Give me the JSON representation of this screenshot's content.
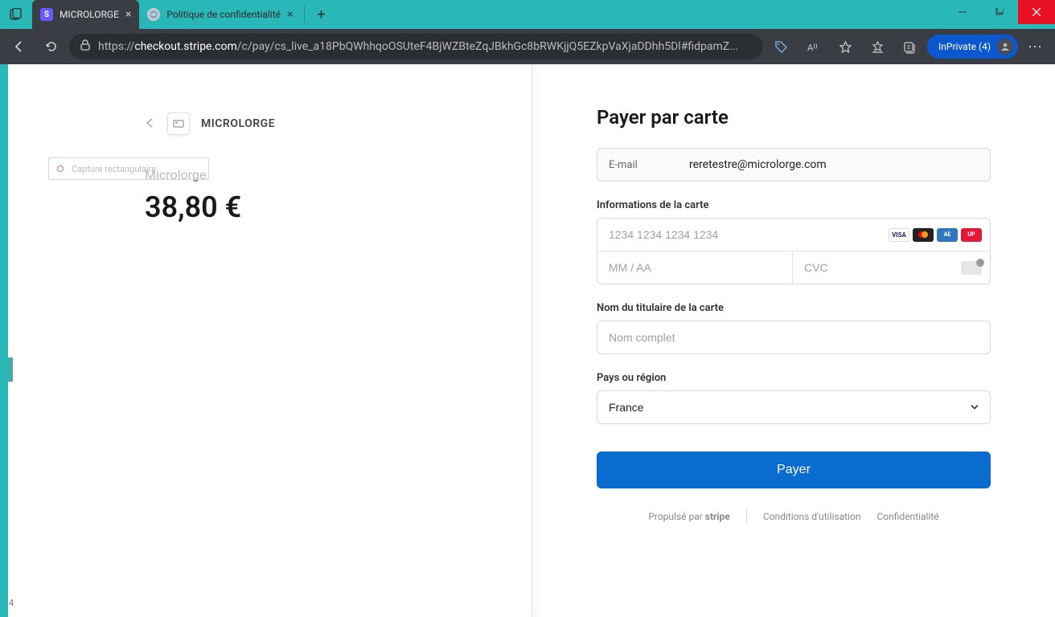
{
  "browser": {
    "tabs": [
      {
        "title": "MICROLORGE",
        "active": true
      },
      {
        "title": "Politique de confidentialité",
        "active": false
      }
    ],
    "url_prefix": "https://",
    "url_domain": "checkout.stripe.com",
    "url_path": "/c/pay/cs_live_a18PbQWhhqoOSUteF4BjWZBteZqJBkhGc8bRWKjjQ5EZkpVaXjaDDhh5Dl#fidpamZ...",
    "inprivate_label": "InPrivate (4)"
  },
  "snip_label": "Capture rectangulaire",
  "merchant": {
    "name": "MICROLORGE",
    "product": "Microlorge",
    "price": "38,80 €"
  },
  "checkout": {
    "title": "Payer par carte",
    "email_label": "E-mail",
    "email_value": "reretestre@microlorge.com",
    "card_info_label": "Informations de la carte",
    "card_number_placeholder": "1234 1234 1234 1234",
    "expiry_placeholder": "MM / AA",
    "cvc_placeholder": "CVC",
    "cardholder_label": "Nom du titulaire de la carte",
    "cardholder_placeholder": "Nom complet",
    "country_label": "Pays ou région",
    "country_value": "France",
    "pay_button": "Payer"
  },
  "footer": {
    "powered_by": "Propulsé par ",
    "stripe": "stripe",
    "terms": "Conditions d'utilisation",
    "privacy": "Confidentialité"
  },
  "marker_text": "4"
}
